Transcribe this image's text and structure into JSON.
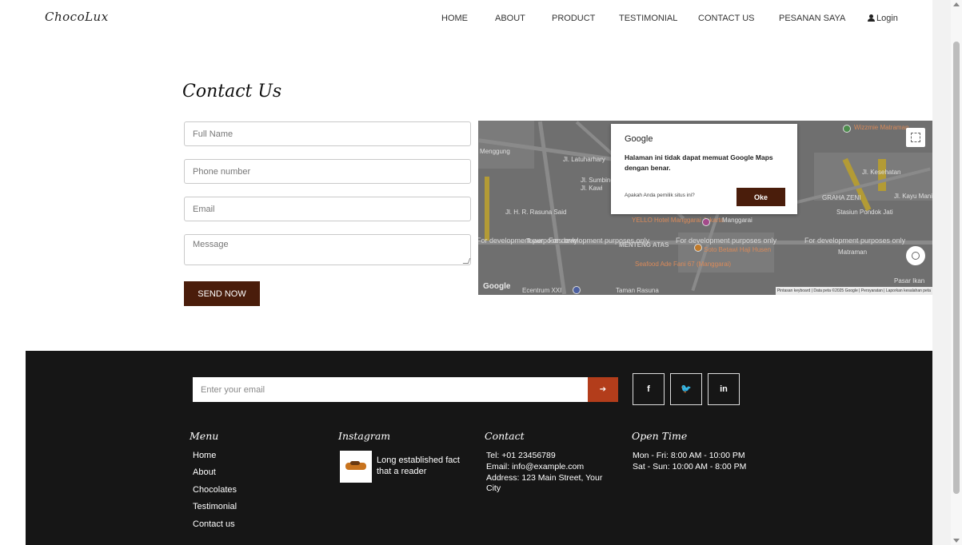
{
  "header": {
    "logo": "ChocoLux",
    "nav": [
      "HOME",
      "ABOUT",
      "PRODUCT",
      "TESTIMONIAL",
      "CONTACT US",
      "PESANAN SAYA"
    ],
    "login_label": "Login"
  },
  "contact": {
    "title": "Contact Us",
    "full_name_placeholder": "Full Name",
    "phone_placeholder": "Phone number",
    "email_placeholder": "Email",
    "message_placeholder": "Message",
    "send_label": "SEND NOW"
  },
  "map": {
    "dialog_brand": "Google",
    "dialog_message": "Halaman ini tidak dapat memuat Google Maps dengan benar.",
    "dialog_owner_question": "Apakah Anda pemilik situs ini?",
    "dialog_ok": "Oke",
    "dev_notice": "For development purposes only",
    "google_mark": "Google",
    "attribution": "Pintasan keyboard | Data peta ©2025 Google | Persyaratan | Laporkan kesalahan peta",
    "labels": {
      "wizzmie": "Wizzmie Matraman",
      "stasiun": "Stasiun Pondok Jati",
      "yello": "YELLO Hotel Manggarai Jakarta",
      "manggarai": "Manggarai",
      "menteng": "MENTENG ATAS",
      "soto": "Soto Betawi Haji Husen",
      "matraman": "Matraman",
      "seafood": "Seafood Ade Fani 67 (Manggarai)",
      "ecentrum": "Ecentrum XXI",
      "taman": "Taman Rasuna",
      "pasar": "Pasar Ikan",
      "graha": "GRAHA ZENI",
      "kayu": "Jl. Kayu Manis",
      "latuharhari": "Jl. Latuharhary",
      "kasuari": "Jl. Kesehatan",
      "mungguna": "Menggung",
      "sumbing": "Jl. Sumbing",
      "kawi": "Jl. Kawi",
      "hr_rasuna": "Jl. H. R. Rasuna Said",
      "tower": "Tower"
    },
    "colors": {
      "base": "#6f6f6f",
      "roads": "#8a8a8a",
      "highlight_roads": "#b39b35"
    }
  },
  "footer": {
    "email_placeholder": "Enter your email",
    "submit_arrow": "➔",
    "social": [
      "f",
      "🐦",
      "in"
    ],
    "menu_title": "Menu",
    "menu_items": [
      "Home",
      "About",
      "Chocolates",
      "Testimonial",
      "Contact us"
    ],
    "instagram_title": "Instagram",
    "instagram_text": "Long established fact that a reader",
    "contact_title": "Contact",
    "tel": "Tel: +01 23456789",
    "email": "Email: info@example.com",
    "address": "Address: 123 Main Street, Your City",
    "open_title": "Open Time",
    "hours_weekday": "Mon - Fri: 8:00 AM - 10:00 PM",
    "hours_weekend": "Sat - Sun: 10:00 AM - 8:00 PM"
  },
  "colors": {
    "accent": "#4a1d0b",
    "footer_bg": "#161616",
    "subscribe_btn": "#b33d1b"
  }
}
